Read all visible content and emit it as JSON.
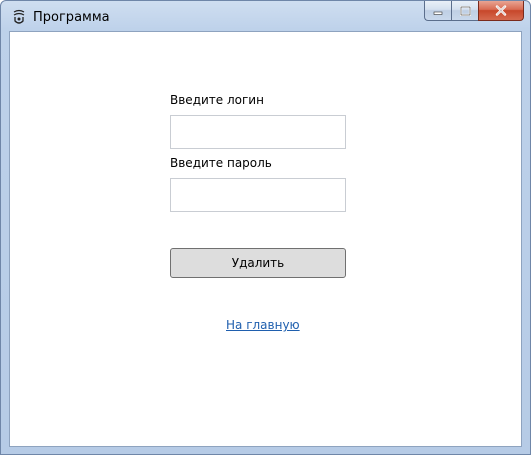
{
  "window": {
    "title": "Программа",
    "controls": {
      "minimize_icon": "minimize-icon",
      "maximize_icon": "maximize-icon",
      "close_icon": "close-icon"
    }
  },
  "form": {
    "login_label": "Введите логин",
    "login_value": "",
    "password_label": "Введите пароль",
    "password_value": "",
    "delete_button_label": "Удалить",
    "home_link_text": "На главную"
  },
  "colors": {
    "link": "#1f5fae",
    "button_bg": "#dddddd",
    "close_button": "#c7472a"
  }
}
